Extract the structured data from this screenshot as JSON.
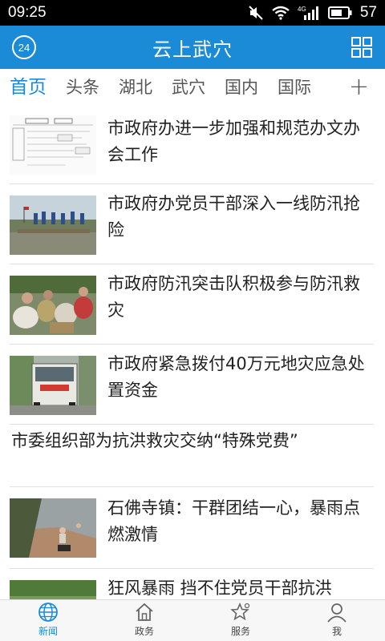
{
  "status": {
    "time": "09:25",
    "network": "4G",
    "battery": "57",
    "icons": [
      "mute-icon",
      "wifi-icon",
      "signal-icon",
      "battery-icon"
    ]
  },
  "header": {
    "title": "云上武穴",
    "badge": "24",
    "menu_icon": "grid-icon",
    "color": "#1b8bd8"
  },
  "tabs": {
    "items": [
      "首页",
      "头条",
      "湖北",
      "武穴",
      "国内",
      "国际"
    ],
    "active_index": 0,
    "add_label": "+"
  },
  "news": [
    {
      "title": "市政府办进一步加强和规范办文办会工作",
      "thumb": "document-flowchart-image"
    },
    {
      "title": "市政府办党员干部深入一线防汛抢险",
      "thumb": "flood-rescue-team-image"
    },
    {
      "title": "市政府防汛突击队积极参与防汛救灾",
      "thumb": "sandbag-crowd-image"
    },
    {
      "title": "市政府紧急拨付40万元地灾应急处置资金",
      "thumb": "emergency-truck-image"
    },
    {
      "title": "市委组织部为抗洪救灾交纳“特殊党费”"
    },
    {
      "title": "石佛寺镇：干群团结一心，暴雨点燃激情",
      "thumb": "riverbank-workers-image"
    },
    {
      "title": "狂风暴雨 挡不住党员干部抗洪",
      "thumb": "green-field-image"
    }
  ],
  "bottom_nav": {
    "items": [
      {
        "label": "新闻",
        "icon": "globe-icon"
      },
      {
        "label": "政务",
        "icon": "home-icon"
      },
      {
        "label": "服务",
        "icon": "star-icon"
      },
      {
        "label": "我",
        "icon": "user-icon"
      }
    ],
    "active_index": 0
  }
}
